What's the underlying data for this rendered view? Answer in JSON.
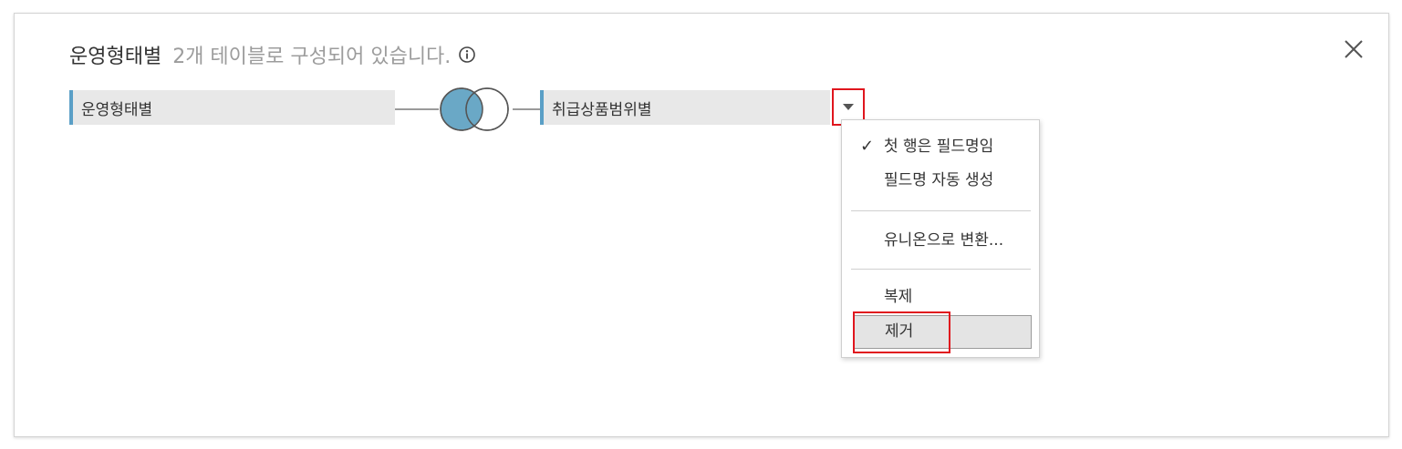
{
  "header": {
    "title": "운영형태별",
    "subtitle": "2개 테이블로 구성되어 있습니다.",
    "info_icon": "info-circle-icon",
    "close_icon": "close-icon"
  },
  "join": {
    "left_table": "운영형태별",
    "right_table": "취급상품범위별",
    "join_icon": "inner-join-venn-icon",
    "accent_color": "#5a9fc6",
    "venn_fill": "#6aa8c6"
  },
  "menu": {
    "items": [
      {
        "label": "첫 행은 필드명임",
        "checked": true
      },
      {
        "label": "필드명 자동 생성",
        "checked": false
      },
      {
        "label": "유니온으로 변환...",
        "checked": false
      },
      {
        "label": "복제",
        "checked": false
      },
      {
        "label": "제거",
        "checked": false,
        "highlighted": true
      }
    ],
    "check_glyph": "✓"
  },
  "colors": {
    "highlight_outline": "#e0161e"
  }
}
